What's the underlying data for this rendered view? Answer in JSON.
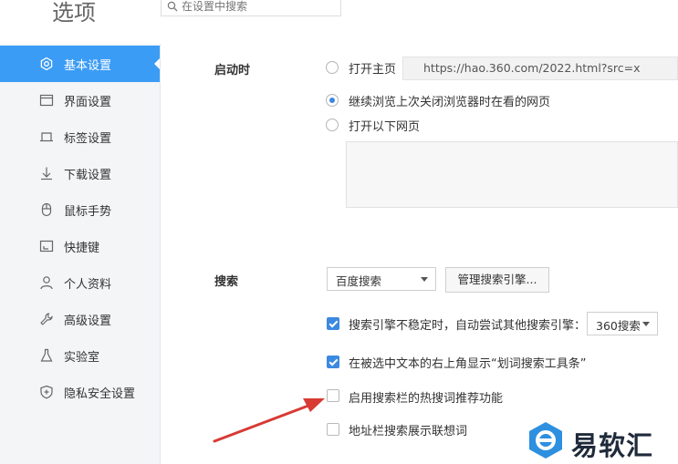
{
  "header": {
    "title": "选项",
    "search_placeholder": "在设置中搜索"
  },
  "sidebar": {
    "items": [
      {
        "label": "基本设置",
        "icon": "gear-icon",
        "active": true
      },
      {
        "label": "界面设置",
        "icon": "window-icon"
      },
      {
        "label": "标签设置",
        "icon": "tab-icon"
      },
      {
        "label": "下载设置",
        "icon": "download-icon"
      },
      {
        "label": "鼠标手势",
        "icon": "mouse-icon"
      },
      {
        "label": "快捷键",
        "icon": "shortcut-icon"
      },
      {
        "label": "个人资料",
        "icon": "user-icon"
      },
      {
        "label": "高级设置",
        "icon": "wrench-icon"
      },
      {
        "label": "实验室",
        "icon": "flask-icon"
      },
      {
        "label": "隐私安全设置",
        "icon": "shield-icon"
      }
    ]
  },
  "startup": {
    "section_label": "启动时",
    "opt_home": "打开主页",
    "home_url": "https://hao.360.com/2022.html?src=x",
    "opt_continue": "继续浏览上次关闭浏览器时在看的网页",
    "opt_pages": "打开以下网页",
    "selected": "continue"
  },
  "search": {
    "section_label": "搜索",
    "engine_value": "百度搜索",
    "manage_button": "管理搜索引擎...",
    "fallback_label": "搜索引擎不稳定时，自动尝试其他搜索引擎：",
    "fallback_engine": "360搜索",
    "fallback_checked": true,
    "toolbar_label": "在被选中文本的右上角显示“划词搜索工具条”",
    "toolbar_checked": true,
    "hotword_label": "启用搜索栏的热搜词推荐功能",
    "hotword_checked": false,
    "suggest_label": "地址栏搜索展示联想词",
    "suggest_checked": false
  },
  "watermark": {
    "text": "易软汇"
  },
  "colors": {
    "accent": "#3b9cf5",
    "checkbox": "#3b89e0",
    "arrow": "#d83a34"
  }
}
